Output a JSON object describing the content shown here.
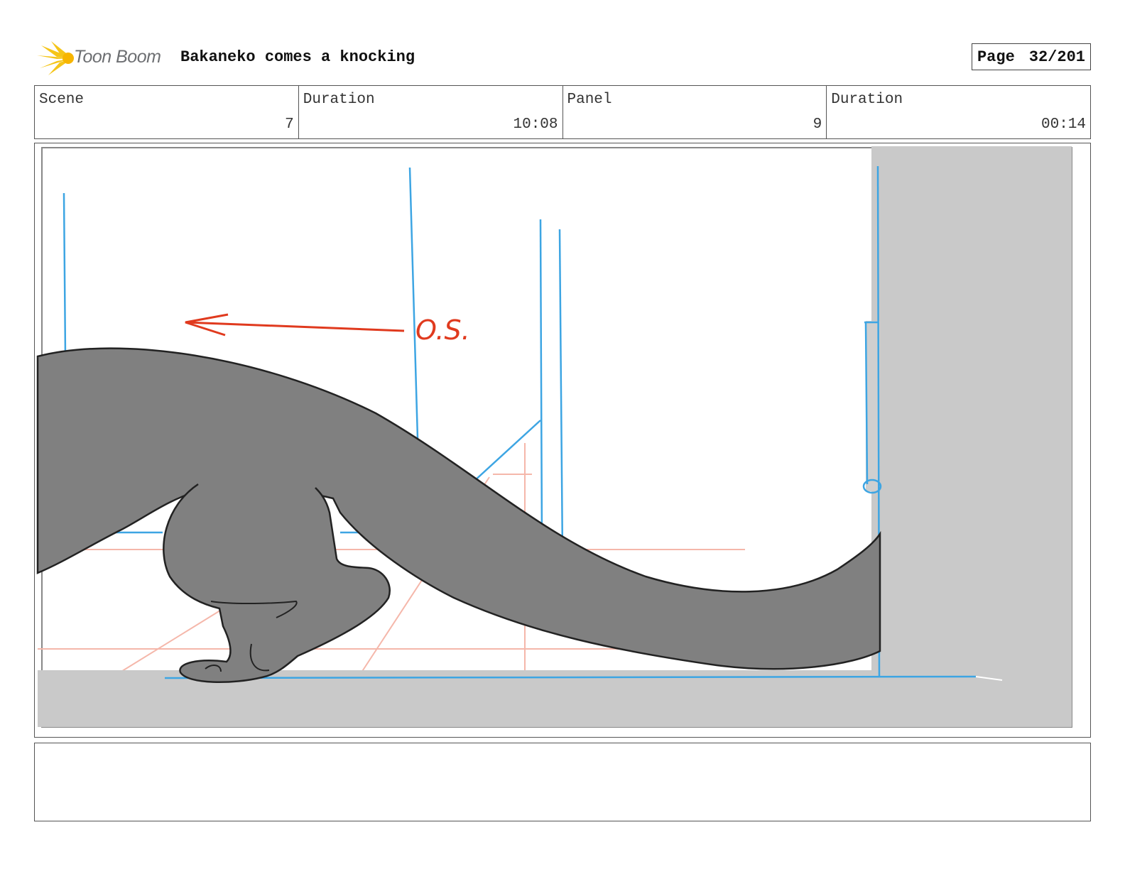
{
  "header": {
    "brand": "Toon Boom",
    "title": "Bakaneko comes a knocking",
    "page_label": "Page",
    "page_value": "32/201"
  },
  "info": {
    "scene_label": "Scene",
    "scene_value": "7",
    "scene_duration_label": "Duration",
    "scene_duration_value": "10:08",
    "panel_label": "Panel",
    "panel_value": "9",
    "panel_duration_label": "Duration",
    "panel_duration_value": "00:14"
  },
  "panel": {
    "annotation": "O.S."
  },
  "notes": {
    "text": ""
  },
  "colors": {
    "guide_blue": "#3da5e3",
    "annotation_red": "#e03a1e",
    "creature_gray": "#808080",
    "wall_gray": "#c9c9c9",
    "logo_yellow": "#f5c518"
  }
}
